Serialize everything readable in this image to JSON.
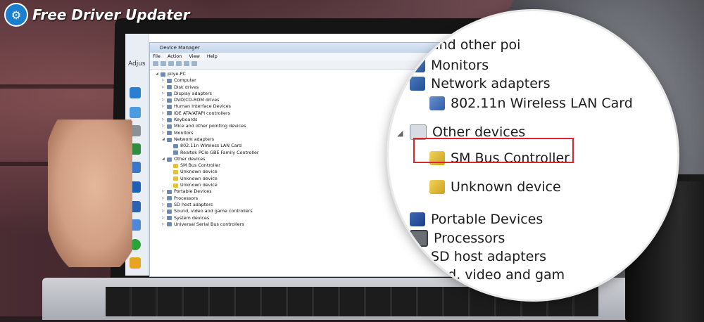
{
  "logo": {
    "text": "Free Driver Updater",
    "mark": "gear"
  },
  "side_label": "Adjus",
  "device_manager": {
    "title": "Device Manager",
    "menu": [
      "File",
      "Action",
      "View",
      "Help"
    ],
    "tree": [
      {
        "label": "pilye-PC",
        "level": 0,
        "expand": "◢"
      },
      {
        "label": "Computer",
        "level": 1,
        "expand": "▷"
      },
      {
        "label": "Disk drives",
        "level": 1,
        "expand": "▷"
      },
      {
        "label": "Display adapters",
        "level": 1,
        "expand": "▷"
      },
      {
        "label": "DVD/CD-ROM drives",
        "level": 1,
        "expand": "▷"
      },
      {
        "label": "Human Interface Devices",
        "level": 1,
        "expand": "▷"
      },
      {
        "label": "IDE ATA/ATAPI controllers",
        "level": 1,
        "expand": "▷"
      },
      {
        "label": "Keyboards",
        "level": 1,
        "expand": "▷"
      },
      {
        "label": "Mice and other pointing devices",
        "level": 1,
        "expand": "▷"
      },
      {
        "label": "Monitors",
        "level": 1,
        "expand": "▷"
      },
      {
        "label": "Network adapters",
        "level": 1,
        "expand": "◢"
      },
      {
        "label": "802.11n Wireless LAN Card",
        "level": 2,
        "expand": ""
      },
      {
        "label": "Realtek PCIe GBE Family Controller",
        "level": 2,
        "expand": ""
      },
      {
        "label": "Other devices",
        "level": 1,
        "expand": "◢"
      },
      {
        "label": "SM Bus Controller",
        "level": 2,
        "expand": "",
        "warn": true
      },
      {
        "label": "Unknown device",
        "level": 2,
        "expand": "",
        "warn": true
      },
      {
        "label": "Unknown device",
        "level": 2,
        "expand": "",
        "warn": true
      },
      {
        "label": "Unknown device",
        "level": 2,
        "expand": "",
        "warn": true
      },
      {
        "label": "Portable Devices",
        "level": 1,
        "expand": "▷"
      },
      {
        "label": "Processors",
        "level": 1,
        "expand": "▷"
      },
      {
        "label": "SD host adapters",
        "level": 1,
        "expand": "▷"
      },
      {
        "label": "Sound, video and game controllers",
        "level": 1,
        "expand": "▷"
      },
      {
        "label": "System devices",
        "level": 1,
        "expand": "▷"
      },
      {
        "label": "Universal Serial Bus controllers",
        "level": 1,
        "expand": "▷"
      }
    ]
  },
  "magnifier": {
    "rows": [
      {
        "label": "and other poi",
        "icon": "mon",
        "indent": 0
      },
      {
        "label": "Monitors",
        "icon": "mon",
        "indent": 0
      },
      {
        "label": "Network adapters",
        "icon": "net",
        "indent": 0
      },
      {
        "label": "802.11n Wireless LAN Card",
        "icon": "card",
        "indent": 1
      },
      {
        "label": "Other devices",
        "icon": "unk",
        "indent": 0
      },
      {
        "label": "SM Bus Controller",
        "icon": "warn",
        "indent": 1
      },
      {
        "label": "Unknown device",
        "icon": "warn",
        "indent": 1
      },
      {
        "label": "Portable Devices",
        "icon": "port",
        "indent": 0
      },
      {
        "label": "Processors",
        "icon": "cpu",
        "indent": 0
      },
      {
        "label": "SD host adapters",
        "icon": "sd",
        "indent": 0
      },
      {
        "label": "und, video and gam",
        "icon": "sd",
        "indent": 0
      }
    ],
    "highlight_color": "#d9262b"
  }
}
